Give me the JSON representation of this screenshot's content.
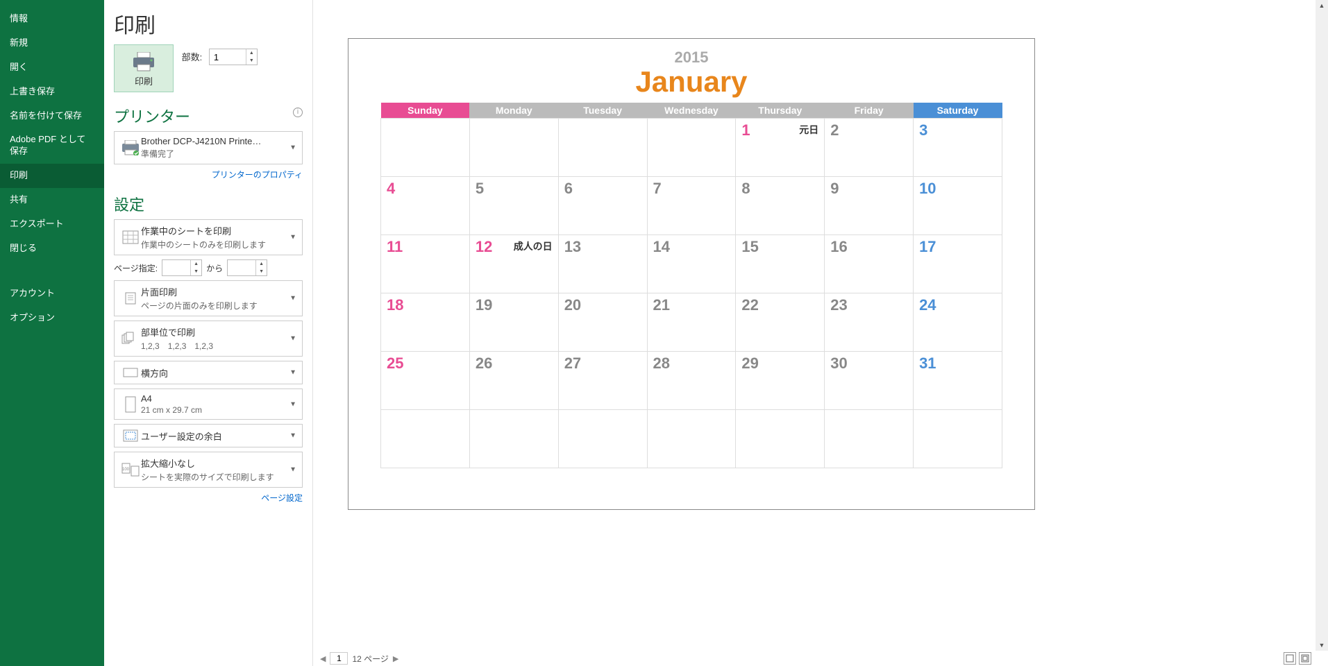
{
  "sidebar": {
    "items": [
      "情報",
      "新規",
      "開く",
      "上書き保存",
      "名前を付けて保存",
      "Adobe PDF として保存",
      "印刷",
      "共有",
      "エクスポート",
      "閉じる",
      "アカウント",
      "オプション"
    ],
    "active": 6
  },
  "panel": {
    "title": "印刷",
    "print_button": "印刷",
    "copies_label": "部数:",
    "copies_value": "1",
    "printer_heading": "プリンター",
    "printer": {
      "name": "Brother DCP-J4210N Printe…",
      "status": "準備完了"
    },
    "printer_props": "プリンターのプロパティ",
    "settings_heading": "設定",
    "opt_sheets": {
      "t1": "作業中のシートを印刷",
      "t2": "作業中のシートのみを印刷します"
    },
    "pages_label": "ページ指定:",
    "pages_sep": "から",
    "opt_sides": {
      "t1": "片面印刷",
      "t2": "ページの片面のみを印刷します"
    },
    "opt_collate": {
      "t1": "部単位で印刷",
      "t2": "1,2,3　1,2,3　1,2,3"
    },
    "opt_orient": {
      "t1": "横方向"
    },
    "opt_paper": {
      "t1": "A4",
      "t2": "21 cm x 29.7 cm"
    },
    "opt_margin": {
      "t1": "ユーザー設定の余白"
    },
    "opt_scale": {
      "t1": "拡大縮小なし",
      "t2": "シートを実際のサイズで印刷します"
    },
    "page_setup": "ページ設定"
  },
  "preview": {
    "year": "2015",
    "month": "January",
    "days": [
      "Sunday",
      "Monday",
      "Tuesday",
      "Wednesday",
      "Thursday",
      "Friday",
      "Saturday"
    ],
    "cells": [
      [
        {
          "n": ""
        },
        {
          "n": ""
        },
        {
          "n": ""
        },
        {
          "n": ""
        },
        {
          "n": "1",
          "hol": true,
          "ev": "元日"
        },
        {
          "n": "2"
        },
        {
          "n": "3"
        }
      ],
      [
        {
          "n": "4"
        },
        {
          "n": "5"
        },
        {
          "n": "6"
        },
        {
          "n": "7"
        },
        {
          "n": "8"
        },
        {
          "n": "9"
        },
        {
          "n": "10"
        }
      ],
      [
        {
          "n": "11"
        },
        {
          "n": "12",
          "hol": true,
          "ev": "成人の日"
        },
        {
          "n": "13"
        },
        {
          "n": "14"
        },
        {
          "n": "15"
        },
        {
          "n": "16"
        },
        {
          "n": "17"
        }
      ],
      [
        {
          "n": "18"
        },
        {
          "n": "19"
        },
        {
          "n": "20"
        },
        {
          "n": "21"
        },
        {
          "n": "22"
        },
        {
          "n": "23"
        },
        {
          "n": "24"
        }
      ],
      [
        {
          "n": "25"
        },
        {
          "n": "26"
        },
        {
          "n": "27"
        },
        {
          "n": "28"
        },
        {
          "n": "29"
        },
        {
          "n": "30"
        },
        {
          "n": "31"
        }
      ],
      [
        {
          "n": ""
        },
        {
          "n": ""
        },
        {
          "n": ""
        },
        {
          "n": ""
        },
        {
          "n": ""
        },
        {
          "n": ""
        },
        {
          "n": ""
        }
      ]
    ],
    "footer": {
      "current": "1",
      "total": "12 ページ"
    }
  }
}
